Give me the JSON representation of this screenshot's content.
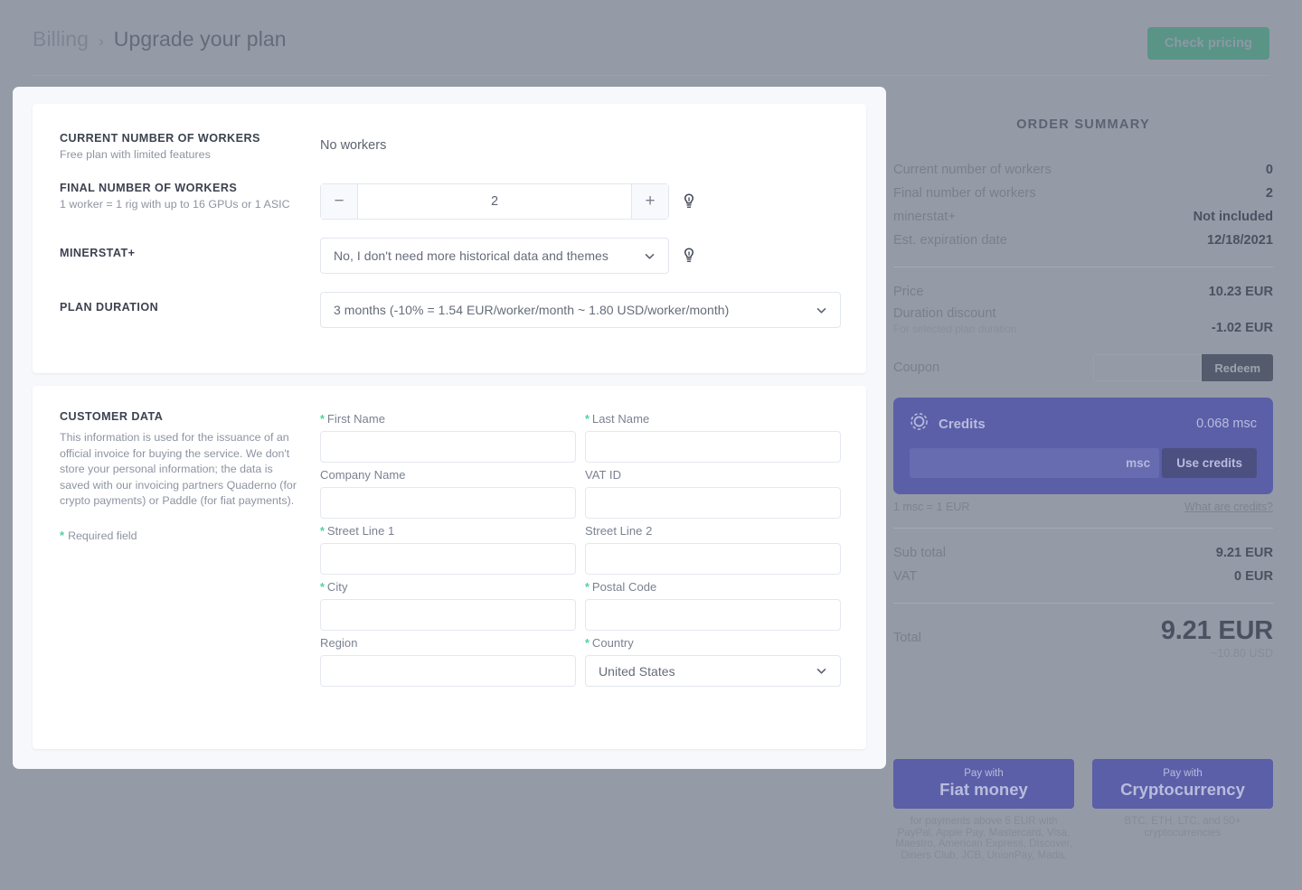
{
  "header": {
    "breadcrumb_parent": "Billing",
    "breadcrumb_separator": "›",
    "breadcrumb_current": "Upgrade your plan",
    "check_pricing_label": "Check pricing",
    "accent_color": "#5a9487"
  },
  "plan": {
    "current_workers": {
      "title": "CURRENT NUMBER OF WORKERS",
      "subtitle": "Free plan with limited features",
      "value": "No workers"
    },
    "final_workers": {
      "title": "FINAL NUMBER OF WORKERS",
      "subtitle": "1 worker = 1 rig with up to 16 GPUs or 1 ASIC",
      "value": "2",
      "decrement_label": "−",
      "increment_label": "+"
    },
    "minerstat_plus": {
      "title": "MINERSTAT+",
      "selected": "No, I don't need more historical data and themes"
    },
    "plan_duration": {
      "title": "PLAN DURATION",
      "selected": "3 months (-10% = 1.54 EUR/worker/month ~ 1.80 USD/worker/month)"
    }
  },
  "customer": {
    "title": "CUSTOMER DATA",
    "description": "This information is used for the issuance of an official invoice for buying the service. We don't store your personal information; the data is saved with our invoicing partners Quaderno (for crypto payments) or Paddle (for fiat payments).",
    "required_note": "Required field",
    "required_marker": "*",
    "required_color": "#4ed39a",
    "fields": [
      {
        "label": "First Name",
        "required": true,
        "value": "",
        "type": "text"
      },
      {
        "label": "Last Name",
        "required": true,
        "value": "",
        "type": "text"
      },
      {
        "label": "Company Name",
        "required": false,
        "value": "",
        "type": "text"
      },
      {
        "label": "VAT ID",
        "required": false,
        "value": "",
        "type": "text"
      },
      {
        "label": "Street Line 1",
        "required": true,
        "value": "",
        "type": "text"
      },
      {
        "label": "Street Line 2",
        "required": false,
        "value": "",
        "type": "text"
      },
      {
        "label": "City",
        "required": true,
        "value": "",
        "type": "text"
      },
      {
        "label": "Postal Code",
        "required": true,
        "value": "",
        "type": "text"
      },
      {
        "label": "Region",
        "required": false,
        "value": "",
        "type": "text"
      },
      {
        "label": "Country",
        "required": true,
        "value": "United States",
        "type": "select"
      }
    ]
  },
  "summary": {
    "title": "ORDER SUMMARY",
    "rows": [
      {
        "key": "Current number of workers",
        "value": "0"
      },
      {
        "key": "Final number of workers",
        "value": "2"
      },
      {
        "key": "minerstat+",
        "value": "Not included"
      },
      {
        "key": "Est. expiration date",
        "value": "12/18/2021"
      }
    ],
    "price_key": "Price",
    "price_value": "10.23 EUR",
    "discount_key": "Duration discount",
    "discount_sub": "For selected plan duration",
    "discount_value": "-1.02 EUR",
    "coupon_label": "Coupon",
    "coupon_value": "",
    "redeem_label": "Redeem",
    "credits": {
      "icon": "coin-icon",
      "label": "Credits",
      "balance": "0.068 msc",
      "input_value": "",
      "unit": "msc",
      "use_label": "Use credits",
      "rate_note": "1 msc = 1 EUR",
      "help_link": "What are credits?",
      "card_color": "#5a5fa8"
    },
    "subtotal_key": "Sub total",
    "subtotal_value": "9.21 EUR",
    "vat_key": "VAT",
    "vat_value": "0 EUR",
    "total_key": "Total",
    "total_value": "9.21 EUR",
    "total_sub": "~10.80 USD"
  },
  "payment": {
    "fiat": {
      "small": "Pay with",
      "big": "Fiat money",
      "note": "for payments above 5 EUR with PayPal, Apple Pay, Mastercard, Visa, Maestro, American Express, Discover, Diners Club, JCB, UnionPay, Mada,"
    },
    "crypto": {
      "small": "Pay with",
      "big": "Cryptocurrency",
      "note": "BTC, ETH, LTC, and 50+ cryptocurrencies"
    }
  }
}
